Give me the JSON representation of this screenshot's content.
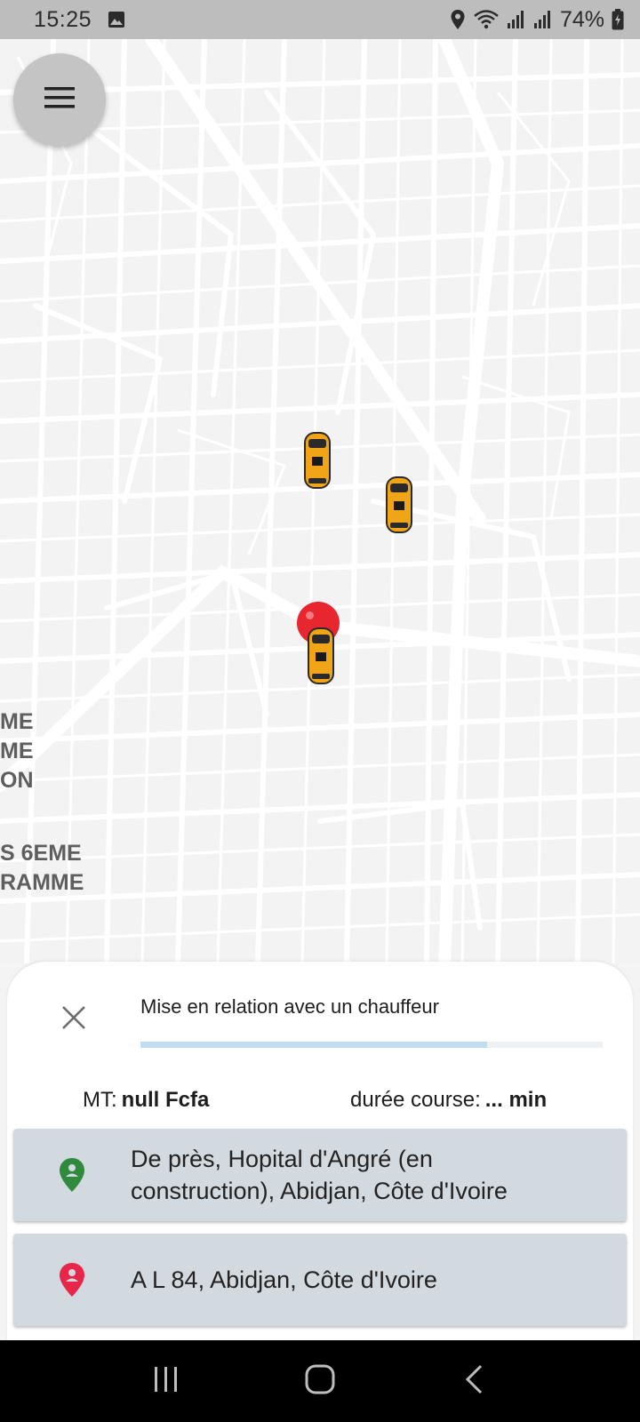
{
  "status_bar": {
    "time": "15:25",
    "battery": "74%",
    "icons": [
      "image-icon",
      "location-icon",
      "wifi-icon",
      "signal-icon",
      "signal-icon",
      "battery-charging-icon"
    ]
  },
  "map": {
    "labels": [
      "ME\nME\nON",
      "S 6EME\nRAMME"
    ],
    "markers": [
      "taxi-car-icon",
      "taxi-car-icon",
      "taxi-car-icon",
      "pickup-pin-icon"
    ]
  },
  "menu": {
    "icon": "hamburger-menu-icon"
  },
  "sheet": {
    "status_text": "Mise en relation avec un chauffeur",
    "progress": 0.75,
    "amount_label": "MT:",
    "amount_value": "null Fcfa",
    "duration_label": "durée course:",
    "duration_value": "... min",
    "origin": "De près, Hopital d'Angré (en construction), Abidjan, Côte d'Ivoire",
    "destination": "A L 84, Abidjan, Côte d'Ivoire"
  },
  "colors": {
    "origin_pin": "#2e8b3e",
    "destination_pin": "#e8264a",
    "card_bg": "#d2d9df",
    "progress_fill": "#bfdcf3",
    "taxi": "#f0a418"
  },
  "nav_bar": {
    "buttons": [
      "recent-apps-icon",
      "home-icon",
      "back-icon"
    ]
  }
}
